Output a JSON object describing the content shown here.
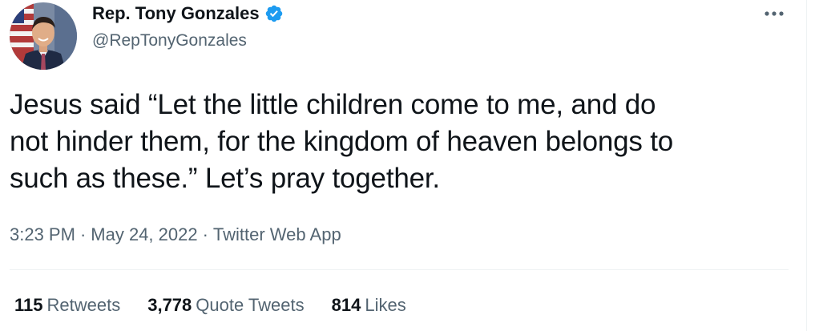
{
  "author": {
    "display_name": "Rep. Tony Gonzales",
    "handle": "@RepTonyGonzales",
    "verified": true,
    "avatar_icon": "profile-photo"
  },
  "tweet": {
    "text": "Jesus said “Let the little children come to me, and do\nnot hinder them, for the kingdom of heaven belongs to\nsuch as these.” Let’s pray together."
  },
  "meta": {
    "time": "3:23 PM",
    "separator": "·",
    "date": "May 24, 2022",
    "source": "Twitter Web App"
  },
  "stats": {
    "retweets_count": "115",
    "retweets_label": "Retweets",
    "quotes_count": "3,778",
    "quotes_label": "Quote Tweets",
    "likes_count": "814",
    "likes_label": "Likes"
  },
  "colors": {
    "text_primary": "#0f1419",
    "text_secondary": "#536471",
    "verified_blue": "#1d9bf0",
    "divider": "#eff3f4"
  },
  "icons": {
    "more": "more-options-icon",
    "verified": "verified-badge-icon"
  }
}
